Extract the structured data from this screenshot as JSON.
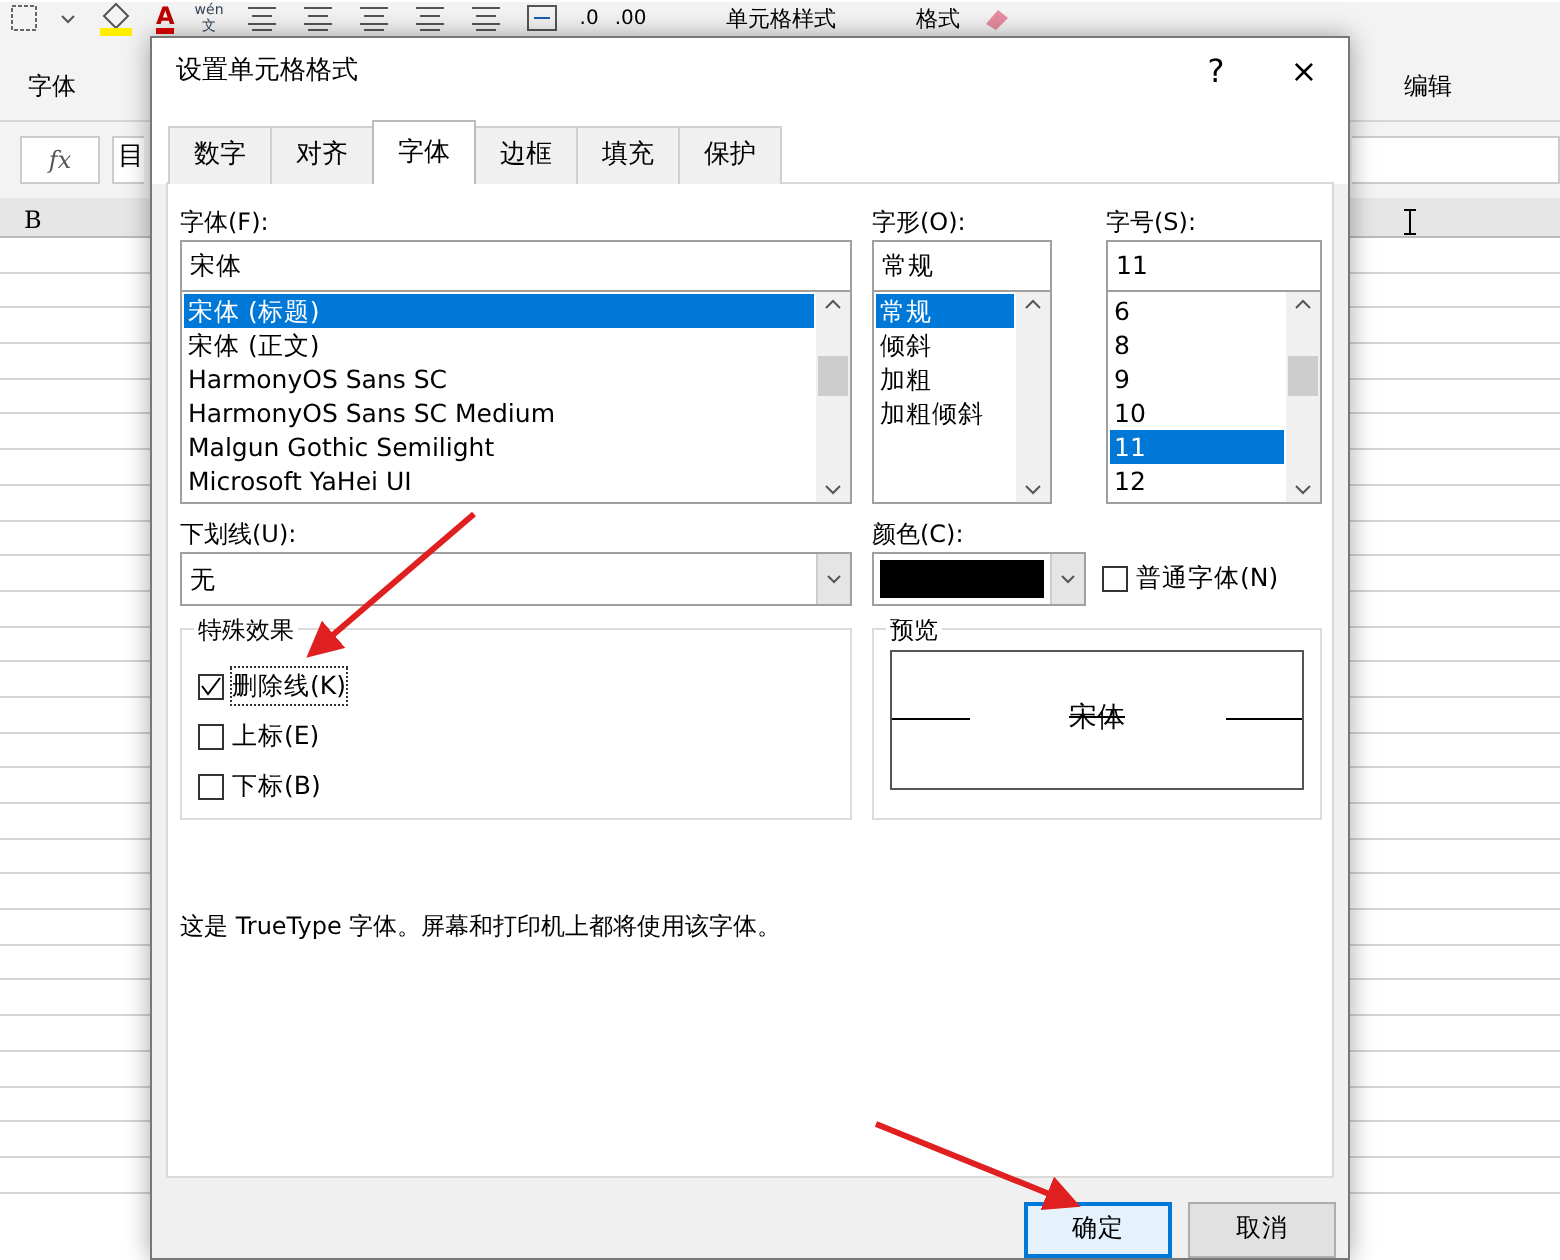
{
  "ribbon": {
    "group_labels": [
      {
        "label": "字体"
      },
      {
        "label": "编辑"
      }
    ],
    "font_color_letter": "A",
    "phonetic": {
      "top": "wén",
      "bottom": "文"
    },
    "decimal": [
      ".0",
      ".00"
    ],
    "commands": [
      {
        "label": "单元格样式"
      },
      {
        "label": "格式"
      }
    ]
  },
  "formula_bar": {
    "fx": "fx",
    "name_box": "目"
  },
  "sheet": {
    "columns": [
      "B"
    ]
  },
  "dialog": {
    "title": "设置单元格格式",
    "help": "?",
    "close": "×",
    "tabs": [
      {
        "label": "数字",
        "selected": false
      },
      {
        "label": "对齐",
        "selected": false
      },
      {
        "label": "字体",
        "selected": true
      },
      {
        "label": "边框",
        "selected": false
      },
      {
        "label": "填充",
        "selected": false
      },
      {
        "label": "保护",
        "selected": false
      }
    ],
    "font": {
      "label": "字体(F):",
      "value": "宋体",
      "items": [
        {
          "label": "宋体 (标题)",
          "selected": true
        },
        {
          "label": "宋体 (正文)",
          "selected": false
        },
        {
          "label": "HarmonyOS Sans SC",
          "selected": false
        },
        {
          "label": "HarmonyOS Sans SC Medium",
          "selected": false
        },
        {
          "label": "Malgun Gothic Semilight",
          "selected": false
        },
        {
          "label": "Microsoft YaHei UI",
          "selected": false
        }
      ]
    },
    "style": {
      "label": "字形(O):",
      "value": "常规",
      "items": [
        {
          "label": "常规",
          "selected": true
        },
        {
          "label": "倾斜",
          "selected": false
        },
        {
          "label": "加粗",
          "selected": false
        },
        {
          "label": "加粗倾斜",
          "selected": false
        }
      ]
    },
    "size": {
      "label": "字号(S):",
      "value": "11",
      "items": [
        {
          "label": "6",
          "selected": false
        },
        {
          "label": "8",
          "selected": false
        },
        {
          "label": "9",
          "selected": false
        },
        {
          "label": "10",
          "selected": false
        },
        {
          "label": "11",
          "selected": true
        },
        {
          "label": "12",
          "selected": false
        }
      ]
    },
    "underline": {
      "label": "下划线(U):",
      "value": "无"
    },
    "color": {
      "label": "颜色(C):",
      "color": "#000000",
      "normal_font": {
        "label": "普通字体(N)",
        "checked": false
      }
    },
    "effects": {
      "title": "特殊效果",
      "items": [
        {
          "label": "删除线(K)",
          "checked": true,
          "focused": true
        },
        {
          "label": "上标(E)",
          "checked": false,
          "focused": false
        },
        {
          "label": "下标(B)",
          "checked": false,
          "focused": false
        }
      ]
    },
    "preview": {
      "title": "预览",
      "text": "宋体",
      "strikethrough": true
    },
    "note": "这是 TrueType 字体。屏幕和打印机上都将使用该字体。",
    "buttons": [
      {
        "label": "确定",
        "default": true
      },
      {
        "label": "取消",
        "default": false
      }
    ]
  }
}
